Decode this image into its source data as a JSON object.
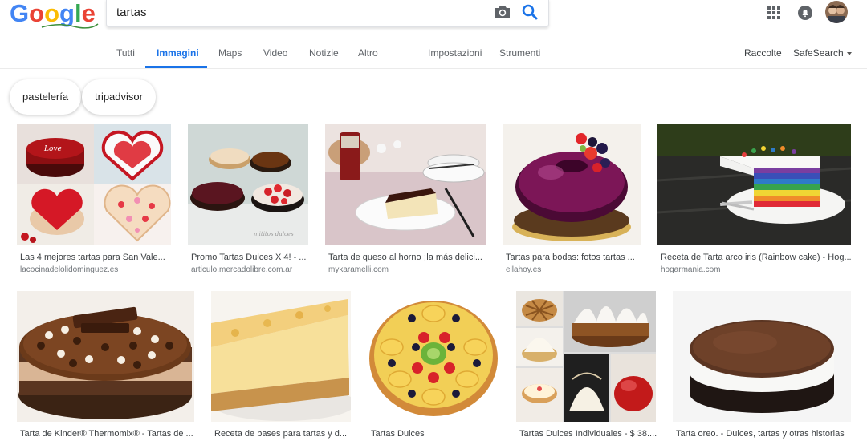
{
  "search": {
    "query": "tartas"
  },
  "logo_text": "Google",
  "nav_tabs": [
    {
      "label": "Tutti"
    },
    {
      "label": "Immagini"
    },
    {
      "label": "Maps"
    },
    {
      "label": "Video"
    },
    {
      "label": "Notizie"
    },
    {
      "label": "Altro"
    },
    {
      "label": "Impostazioni"
    },
    {
      "label": "Strumenti"
    }
  ],
  "right_links": {
    "collections": "Raccolte",
    "safesearch": "SafeSearch"
  },
  "chips": [
    {
      "label": "pastelería"
    },
    {
      "label": "tripadvisor"
    }
  ],
  "colors": {
    "accent": "#1a73e8",
    "caption": "#3c4043",
    "source": "#70757a"
  },
  "results": [
    {
      "caption": "Las 4 mejores tartas para San Vale...",
      "source": "lacocinadelolidominguez.es"
    },
    {
      "caption": "Promo Tartas Dulces X 4! - ...",
      "source": "articulo.mercadolibre.com.ar"
    },
    {
      "caption": "Tarta de queso al horno ¡la más delici...",
      "source": "mykaramelli.com"
    },
    {
      "caption": "Tartas para bodas: fotos tartas ...",
      "source": "ellahoy.es"
    },
    {
      "caption": "Receta de Tarta arco iris (Rainbow cake) - Hog...",
      "source": "hogarmania.com"
    },
    {
      "caption": "Tarta de Kinder® Thermomix® - Tartas de ...",
      "source": ""
    },
    {
      "caption": "Receta de bases para tartas y d...",
      "source": ""
    },
    {
      "caption": "Tartas Dulces",
      "source": ""
    },
    {
      "caption": "Tartas Dulces Individuales - $ 38....",
      "source": ""
    },
    {
      "caption": "Tarta oreo. - Dulces, tartas y otras historias",
      "source": ""
    }
  ],
  "image_watermark": "mititos dulces"
}
